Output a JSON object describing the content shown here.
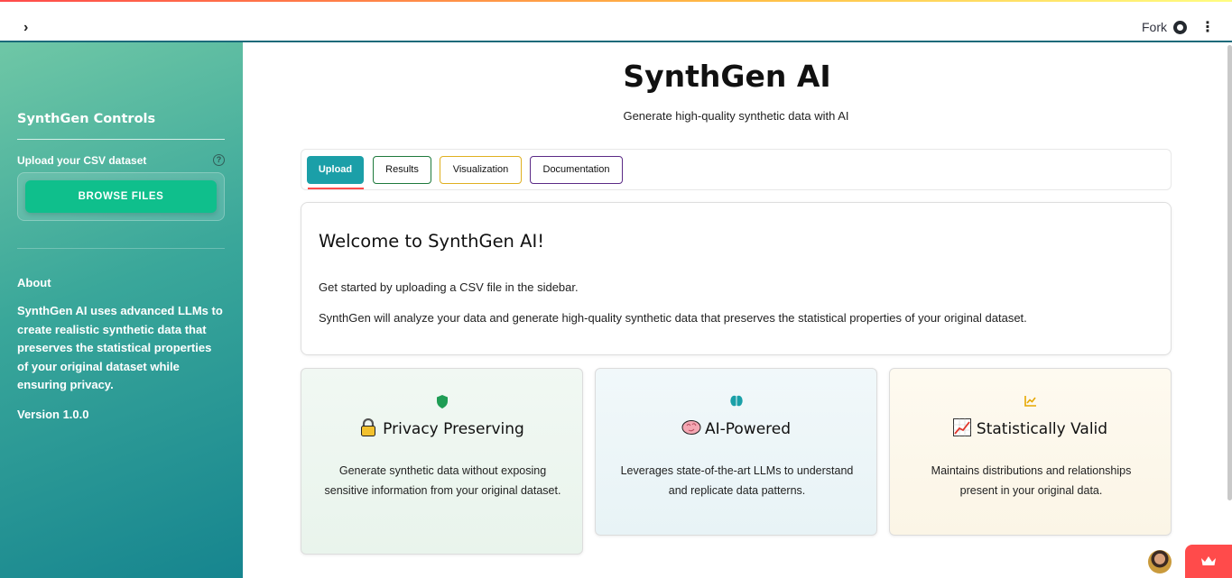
{
  "header": {
    "fork_label": "Fork",
    "expand_glyph": "›",
    "menu_glyph": "⋮"
  },
  "sidebar": {
    "title": "SynthGen Controls",
    "upload_label": "Upload your CSV dataset",
    "help_glyph": "?",
    "browse_button": "BROWSE FILES",
    "about_heading": "About",
    "about_text": "SynthGen AI uses advanced LLMs to create realistic synthetic data that preserves the statistical properties of your original dataset while ensuring privacy.",
    "version": "Version 1.0.0"
  },
  "main": {
    "title": "SynthGen AI",
    "subtitle": "Generate high-quality synthetic data with AI",
    "tabs": [
      {
        "label": "Upload",
        "active": true
      },
      {
        "label": "Results",
        "active": false,
        "border_color": "#1e7a3c"
      },
      {
        "label": "Visualization",
        "active": false,
        "border_color": "#e0b020"
      },
      {
        "label": "Documentation",
        "active": false,
        "border_color": "#5b2a86"
      }
    ],
    "welcome": {
      "heading": "Welcome to SynthGen AI!",
      "p1": "Get started by uploading a CSV file in the sidebar.",
      "p2": "SynthGen will analyze your data and generate high-quality synthetic data that preserves the statistical properties of your original dataset."
    },
    "cards": [
      {
        "icon": "shield-icon",
        "title_icon": "lock-emoji",
        "title": "Privacy Preserving",
        "text": "Generate synthetic data without exposing sensitive information from your original dataset.",
        "bg": "#eef7f1"
      },
      {
        "icon": "brain-icon",
        "title_icon": "brain-emoji",
        "title": "AI-Powered",
        "text": "Leverages state-of-the-art LLMs to understand and replicate data patterns.",
        "bg": "#eef6f8"
      },
      {
        "icon": "chart-line-icon",
        "title_icon": "chart-increasing-emoji",
        "title": "Statistically Valid",
        "text": "Maintains distributions and relationships present in your original data.",
        "bg": "#fdf8ec"
      }
    ]
  },
  "colors": {
    "accent": "#1b9fa8",
    "browse_button": "#0fbf8c",
    "streamlit_red": "#ff4b4b"
  }
}
